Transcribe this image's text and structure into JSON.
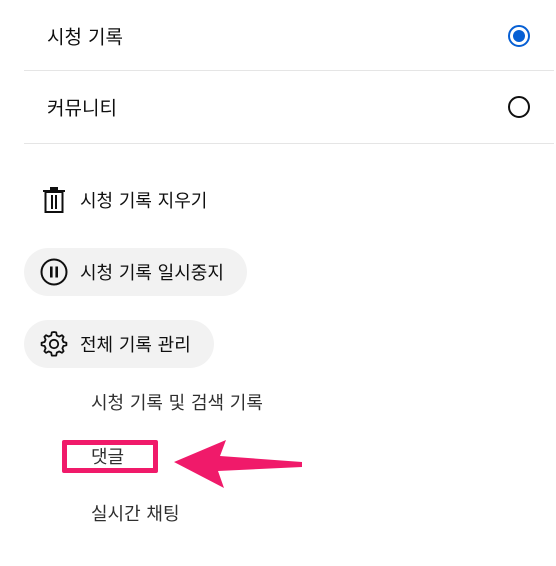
{
  "history_options": [
    {
      "label": "시청 기록",
      "selected": true
    },
    {
      "label": "커뮤니티",
      "selected": false
    }
  ],
  "actions": {
    "clear_history": "시청 기록 지우기",
    "pause_history": "시청 기록 일시중지",
    "manage_history": "전체 기록 관리"
  },
  "manage_links": [
    "시청 기록 및 검색 기록",
    "댓글",
    "실시간 채팅"
  ],
  "annotation": {
    "highlight_color": "#f01a6a",
    "highlighted_item": "댓글"
  },
  "colors": {
    "radio_selected": "#065fd4",
    "pill_background": "#f2f2f2",
    "divider": "#e5e5e5"
  },
  "icons": {
    "clear": "trash-icon",
    "pause": "pause-circle-icon",
    "manage": "gear-icon",
    "annotation": "arrow-left-icon"
  }
}
